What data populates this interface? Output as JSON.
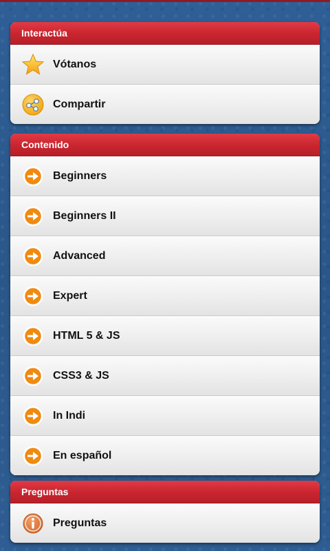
{
  "sections": [
    {
      "title": "Interactúa",
      "items": [
        {
          "label": "Vótanos",
          "icon": "star-icon"
        },
        {
          "label": "Compartir",
          "icon": "share-icon"
        }
      ]
    },
    {
      "title": "Contenido",
      "items": [
        {
          "label": "Beginners",
          "icon": "arrow-right-icon"
        },
        {
          "label": "Beginners II",
          "icon": "arrow-right-icon"
        },
        {
          "label": "Advanced",
          "icon": "arrow-right-icon"
        },
        {
          "label": "Expert",
          "icon": "arrow-right-icon"
        },
        {
          "label": "HTML 5 & JS",
          "icon": "arrow-right-icon"
        },
        {
          "label": "CSS3 & JS",
          "icon": "arrow-right-icon"
        },
        {
          "label": "In Indi",
          "icon": "arrow-right-icon"
        },
        {
          "label": "En español",
          "icon": "arrow-right-icon"
        }
      ]
    },
    {
      "title": "Preguntas",
      "items": [
        {
          "label": "Preguntas",
          "icon": "info-icon"
        }
      ]
    }
  ],
  "colors": {
    "header_red": "#c8252f",
    "background_blue": "#2e5d93",
    "arrow_orange": "#f08a10"
  }
}
